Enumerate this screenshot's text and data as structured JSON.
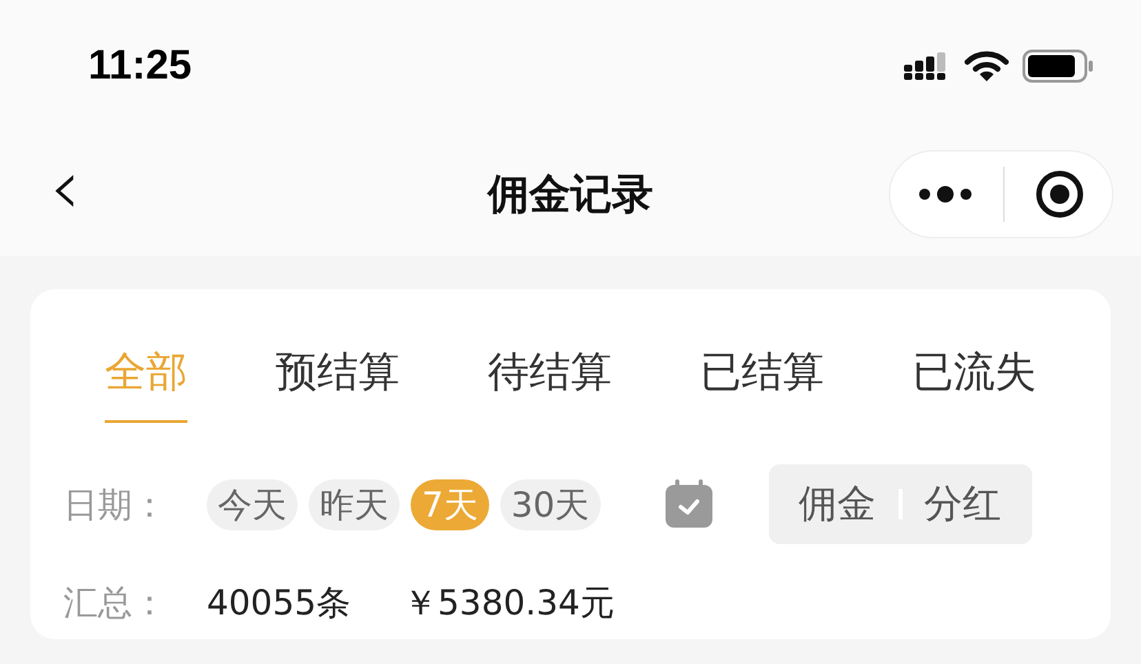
{
  "status_bar": {
    "time": "11:25"
  },
  "nav_bar": {
    "back": "‹",
    "title": "佣金记录"
  },
  "tabs": [
    {
      "label": "全部",
      "selected": true
    },
    {
      "label": "预结算",
      "selected": false
    },
    {
      "label": "待结算",
      "selected": false
    },
    {
      "label": "已结算",
      "selected": false
    },
    {
      "label": "已流失",
      "selected": false
    }
  ],
  "date_filter": {
    "label": "日期：",
    "chips": [
      {
        "label": "今天",
        "selected": false
      },
      {
        "label": "昨天",
        "selected": false
      },
      {
        "label": "7天",
        "selected": true
      },
      {
        "label": "30天",
        "selected": false
      }
    ]
  },
  "type_switch": [
    {
      "label": "佣金",
      "selected": false
    },
    {
      "label": "分红",
      "selected": false
    }
  ],
  "summary": {
    "label": "汇总：",
    "count": "40055条",
    "amount": "￥5380.34元"
  }
}
